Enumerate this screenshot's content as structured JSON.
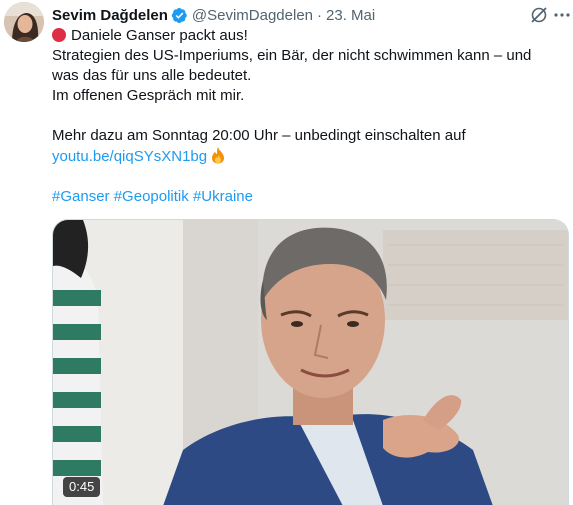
{
  "author": {
    "name": "Sevim Dağdelen",
    "handle": "@SevimDagdelen",
    "separator": "·",
    "date": "23. Mai",
    "verified_icon": "verified-badge-icon",
    "avatar": "avatar"
  },
  "actions": {
    "grok_icon": "grok-icon",
    "more_icon": "more-options-icon"
  },
  "tweet": {
    "line1": "Daniele Ganser packt aus!",
    "line2": "Strategien des US-Imperiums, ein Bär, der nicht schwimmen kann – und",
    "line3": "was das für uns alle bedeutet.",
    "line4": "Im offenen Gespräch mit mir.",
    "line5": "Mehr dazu am Sonntag 20:00 Uhr – unbedingt einschalten auf",
    "link": "youtu.be/qiqSYsXN1bg",
    "hashtags": [
      "#Ganser",
      "#Geopolitik",
      "#Ukraine"
    ]
  },
  "video": {
    "duration": "0:45"
  },
  "colors": {
    "link": "#1d9bf0",
    "text": "#0f1419",
    "secondary": "#536471",
    "red_circle": "#dd2e44"
  }
}
